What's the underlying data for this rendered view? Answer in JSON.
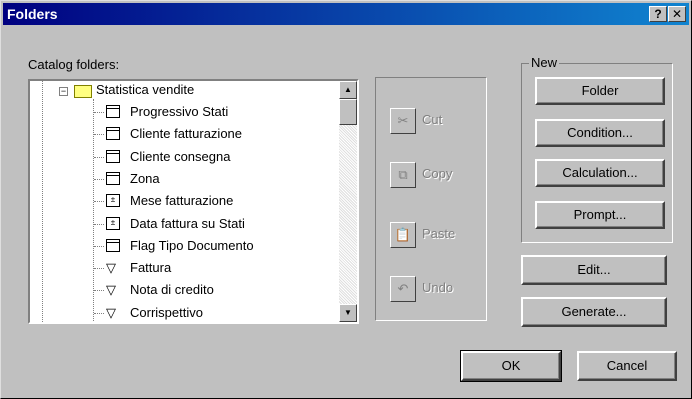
{
  "window": {
    "title": "Folders",
    "help_label": "?",
    "close_label": "✕"
  },
  "catalog_label": "Catalog folders:",
  "tree": {
    "root": {
      "label": "Statistica vendite",
      "expander": "−"
    },
    "items": [
      {
        "label": "Progressivo Stati",
        "icon": "sheet-icon"
      },
      {
        "label": "Cliente fatturazione",
        "icon": "sheet-icon"
      },
      {
        "label": "Cliente consegna",
        "icon": "sheet-icon"
      },
      {
        "label": "Zona",
        "icon": "sheet-icon"
      },
      {
        "label": "Mese fatturazione",
        "icon": "calculation-icon"
      },
      {
        "label": "Data fattura su Stati",
        "icon": "calculation-icon"
      },
      {
        "label": "Flag Tipo Documento",
        "icon": "sheet-icon"
      },
      {
        "label": "Fattura",
        "icon": "filter-icon"
      },
      {
        "label": "Nota di credito",
        "icon": "filter-icon"
      },
      {
        "label": "Corrispettivo",
        "icon": "filter-icon"
      }
    ]
  },
  "clipboard": {
    "cut": "Cut",
    "copy": "Copy",
    "paste": "Paste",
    "undo": "Undo"
  },
  "new_group": {
    "title": "New",
    "folder": "Folder",
    "condition": "Condition...",
    "calculation": "Calculation...",
    "prompt": "Prompt..."
  },
  "actions": {
    "edit": "Edit...",
    "generate": "Generate...",
    "ok": "OK",
    "cancel": "Cancel"
  },
  "colors": {
    "face": "#c0c0c0",
    "titlebar": "#000080",
    "disabled_text": "#808080"
  }
}
